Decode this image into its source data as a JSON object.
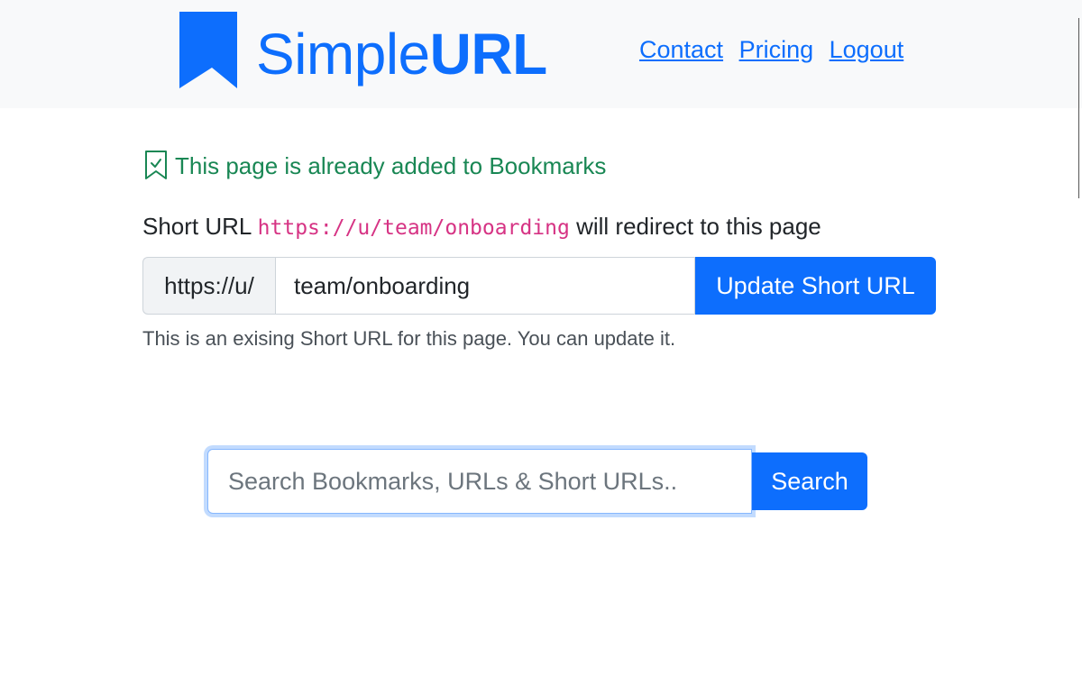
{
  "header": {
    "logo_text_regular": "Simple",
    "logo_text_bold": "URL",
    "nav": [
      {
        "label": "Contact"
      },
      {
        "label": "Pricing"
      },
      {
        "label": "Logout"
      }
    ]
  },
  "alert": {
    "icon": "bookmark-check-icon",
    "text": "This page is already added to Bookmarks"
  },
  "short_url": {
    "prefix_text": "Short URL",
    "url_code": "https://u/team/onboarding",
    "suffix_text": "will redirect to this page",
    "input_prefix": "https://u/",
    "input_value": "team/onboarding",
    "update_button": "Update Short URL",
    "help_text": "This is an exising Short URL for this page. You can update it."
  },
  "search": {
    "placeholder": "Search Bookmarks, URLs & Short URLs..",
    "button": "Search"
  },
  "colors": {
    "primary": "#0d6efd",
    "success": "#198754",
    "code": "#d63384",
    "header_bg": "#f8f9fa"
  }
}
